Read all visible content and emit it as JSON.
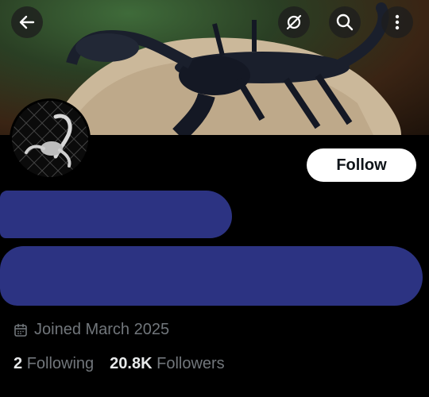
{
  "header": {
    "back_icon": "arrow-left-icon",
    "grok_icon": "grok-icon",
    "search_icon": "search-icon",
    "more_icon": "more-vertical-icon"
  },
  "banner": {
    "subject": "scorpion-on-rock"
  },
  "profile": {
    "follow_label": "Follow",
    "joined_icon": "calendar-icon",
    "joined_text": "Joined March 2025",
    "following_count": "2",
    "following_label": "Following",
    "followers_count": "20.8K",
    "followers_label": "Followers"
  },
  "colors": {
    "background": "#000000",
    "follow_bg": "#ffffff",
    "muted_text": "#71767b",
    "redaction": "#2c3382"
  }
}
